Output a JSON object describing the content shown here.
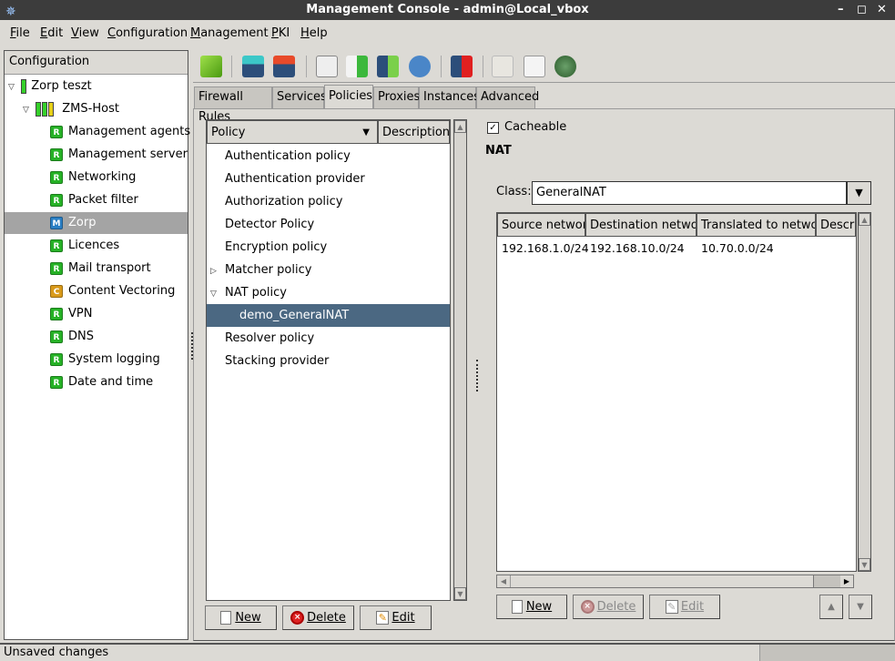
{
  "window": {
    "title": "Management Console - admin@Local_vbox",
    "controls": {
      "minimize": "–",
      "maximize": "◻",
      "close": "✕"
    }
  },
  "menu": [
    "File",
    "Edit",
    "View",
    "Configuration",
    "Management",
    "PKI",
    "Help"
  ],
  "left_panel": {
    "header": "Configuration",
    "tree": [
      {
        "label": "Zorp teszt",
        "level": 0,
        "expanded": true,
        "status": [
          "green"
        ]
      },
      {
        "label": "ZMS-Host",
        "level": 1,
        "expanded": true,
        "status": [
          "green",
          "green",
          "yellow"
        ]
      },
      {
        "label": "Management agents",
        "level": 2,
        "badge": "R"
      },
      {
        "label": "Management server",
        "level": 2,
        "badge": "R"
      },
      {
        "label": "Networking",
        "level": 2,
        "badge": "R"
      },
      {
        "label": "Packet filter",
        "level": 2,
        "badge": "R"
      },
      {
        "label": "Zorp",
        "level": 2,
        "badge": "M",
        "selected": true
      },
      {
        "label": "Licences",
        "level": 2,
        "badge": "R"
      },
      {
        "label": "Mail transport",
        "level": 2,
        "badge": "R"
      },
      {
        "label": "Content Vectoring",
        "level": 2,
        "badge": "C"
      },
      {
        "label": "VPN",
        "level": 2,
        "badge": "R"
      },
      {
        "label": "DNS",
        "level": 2,
        "badge": "R"
      },
      {
        "label": "System logging",
        "level": 2,
        "badge": "R"
      },
      {
        "label": "Date and time",
        "level": 2,
        "badge": "R"
      }
    ]
  },
  "toolbar": {
    "icons": [
      "go-up-icon",
      "save-commit-icon",
      "revert-icon",
      "search-icon",
      "compare-icon",
      "upload-icon",
      "settings-icon",
      "help-save-icon",
      "notes-icon",
      "edit-doc-icon",
      "inspect-icon"
    ]
  },
  "tabs": [
    {
      "label": "Firewall Rules"
    },
    {
      "label": "Services"
    },
    {
      "label": "Policies",
      "active": true
    },
    {
      "label": "Proxies"
    },
    {
      "label": "Instances"
    },
    {
      "label": "Advanced"
    }
  ],
  "policies": {
    "columns": [
      "Policy",
      "Description"
    ],
    "rows": [
      {
        "label": "Authentication policy"
      },
      {
        "label": "Authentication provider"
      },
      {
        "label": "Authorization policy"
      },
      {
        "label": "Detector Policy"
      },
      {
        "label": "Encryption policy"
      },
      {
        "label": "Matcher policy",
        "expander": "collapsed"
      },
      {
        "label": "NAT policy",
        "expander": "expanded"
      },
      {
        "label": "demo_GeneralNAT",
        "child": true,
        "selected": true
      },
      {
        "label": "Resolver policy"
      },
      {
        "label": "Stacking provider"
      }
    ],
    "buttons": {
      "new": "New",
      "delete": "Delete",
      "edit": "Edit"
    }
  },
  "detail": {
    "cacheable_label": "Cacheable",
    "cacheable_checked": true,
    "section_title": "NAT",
    "class_label": "Class:",
    "class_value": "GeneralNAT",
    "nat_columns": [
      "Source network",
      "Destination network",
      "Translated to network",
      "Descri"
    ],
    "nat_rows": [
      [
        "192.168.1.0/24",
        "192.168.10.0/24",
        "10.70.0.0/24",
        ""
      ]
    ],
    "buttons": {
      "new": "New",
      "delete": "Delete",
      "edit": "Edit"
    }
  },
  "status": {
    "text": "Unsaved changes"
  },
  "colors": {
    "selection": "#4b6882",
    "tree_selection": "#a4a4a4",
    "badge_r": "#27b227",
    "badge_m": "#2a7fc4",
    "badge_c": "#d99a1a"
  }
}
